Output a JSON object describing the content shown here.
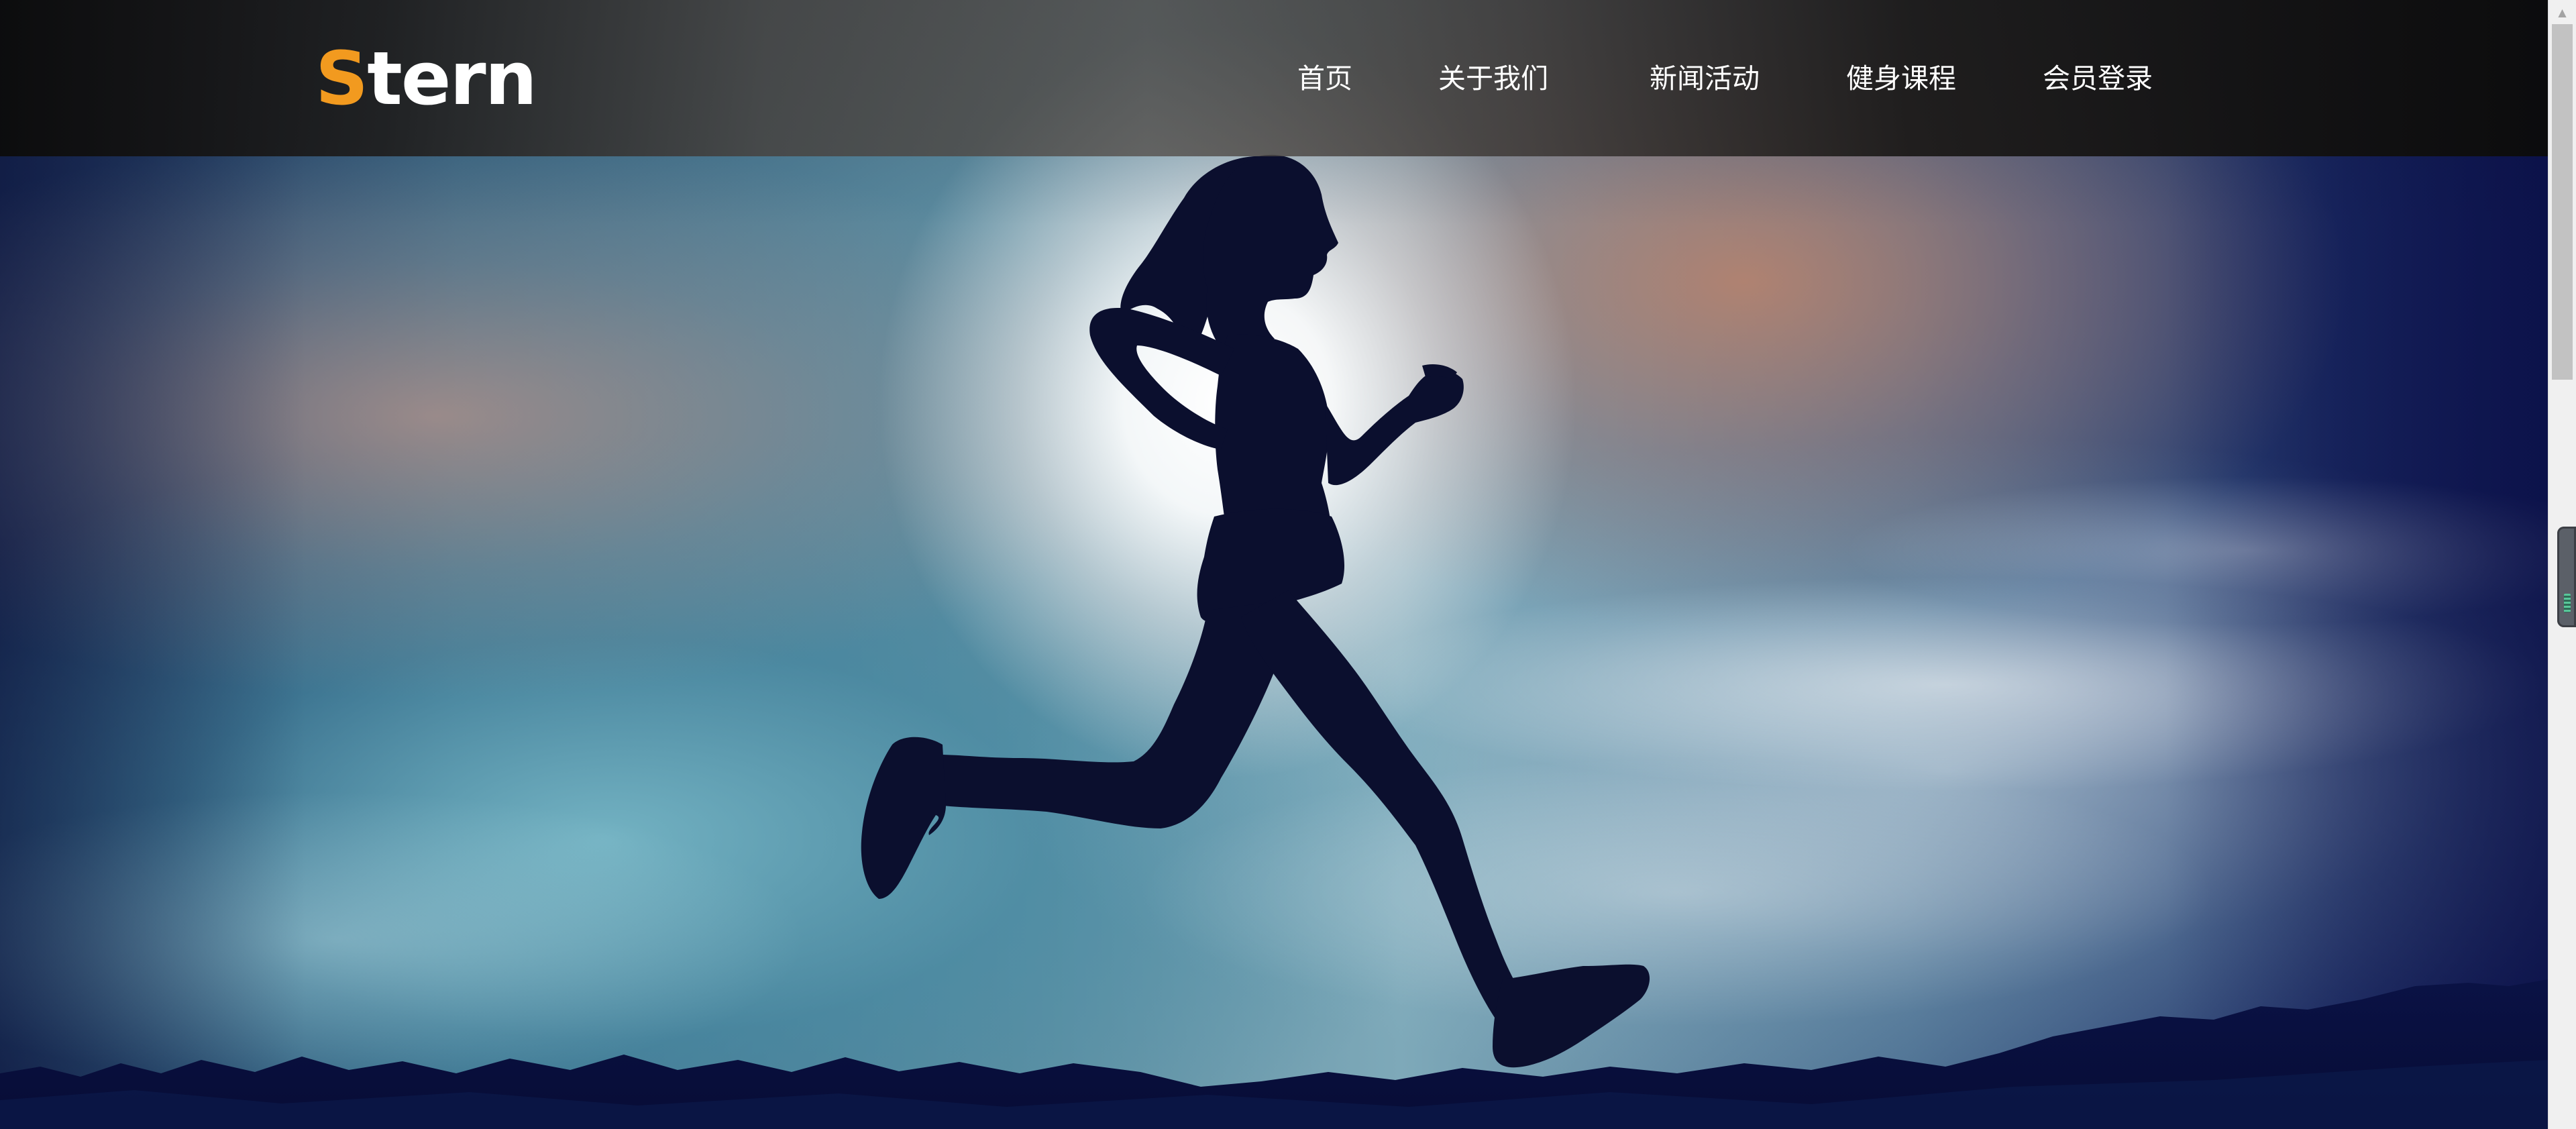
{
  "header": {
    "logo": {
      "first_letter": "S",
      "rest": "tern",
      "accent_color": "#f29a1f"
    },
    "nav": [
      {
        "label": "首页"
      },
      {
        "label": "关于我们"
      },
      {
        "label": "新闻活动"
      },
      {
        "label": "健身课程"
      },
      {
        "label": "会员登录"
      }
    ]
  },
  "hero": {
    "image": "silhouette-of-woman-running-against-sunset-sky"
  },
  "scrollbar": {
    "icon": "scroll-up-arrow-icon"
  },
  "side_widget": {
    "icon": "side-panel-tab-icon"
  }
}
